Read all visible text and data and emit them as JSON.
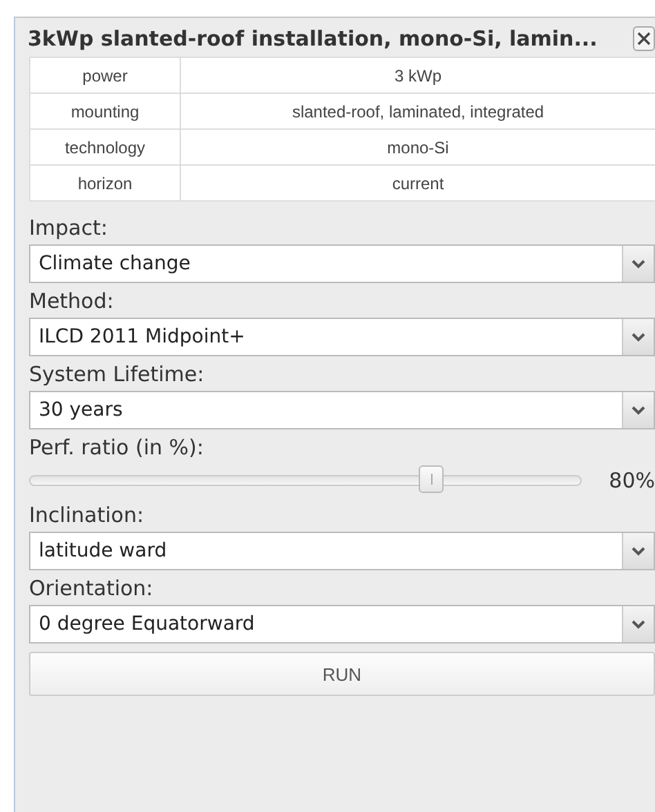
{
  "window": {
    "title": "3kWp slanted-roof installation, mono-Si, lamin..."
  },
  "properties": [
    {
      "name": "power",
      "value": "3 kWp"
    },
    {
      "name": "mounting",
      "value": "slanted-roof, laminated, integrated"
    },
    {
      "name": "technology",
      "value": "mono-Si"
    },
    {
      "name": "horizon",
      "value": "current"
    }
  ],
  "fields": [
    {
      "kind": "select",
      "label": "Impact:",
      "value": "Climate change"
    },
    {
      "kind": "select",
      "label": "Method:",
      "value": "ILCD 2011 Midpoint+"
    },
    {
      "kind": "select",
      "label": "System Lifetime:",
      "value": "30 years"
    },
    {
      "kind": "slider",
      "label": "Perf. ratio (in %):",
      "level": 0.73,
      "reading": "80%"
    },
    {
      "kind": "select",
      "label": "Inclination:",
      "value": "latitude ward"
    },
    {
      "kind": "select",
      "label": "Orientation:",
      "value": "0 degree Equatorward"
    }
  ],
  "run_button": "RUN"
}
